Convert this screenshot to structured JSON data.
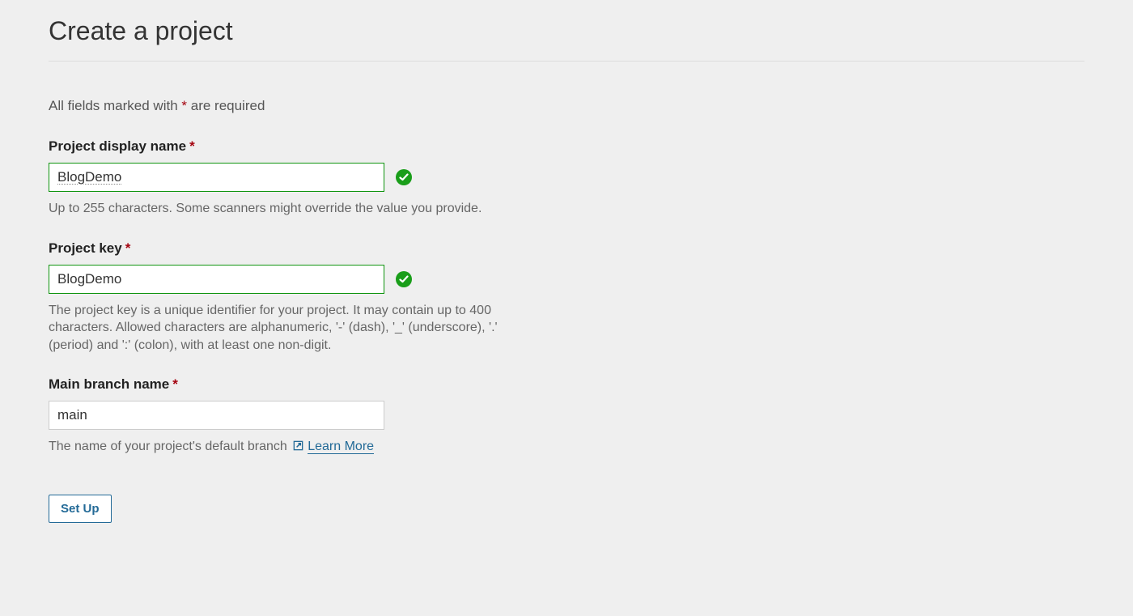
{
  "header": {
    "title": "Create a project"
  },
  "required_note": {
    "prefix": "All fields marked with ",
    "asterisk": "*",
    "suffix": " are required"
  },
  "fields": {
    "display_name": {
      "label": "Project display name",
      "value": "BlogDemo",
      "help": "Up to 255 characters. Some scanners might override the value you provide."
    },
    "project_key": {
      "label": "Project key",
      "value": "BlogDemo",
      "help": "The project key is a unique identifier for your project. It may contain up to 400 characters. Allowed characters are alphanumeric, '-' (dash), '_' (underscore), '.' (period) and ':' (colon), with at least one non-digit."
    },
    "main_branch": {
      "label": "Main branch name",
      "value": "main",
      "help_prefix": "The name of your project's default branch ",
      "learn_more": "Learn More"
    }
  },
  "actions": {
    "setup": "Set Up"
  }
}
